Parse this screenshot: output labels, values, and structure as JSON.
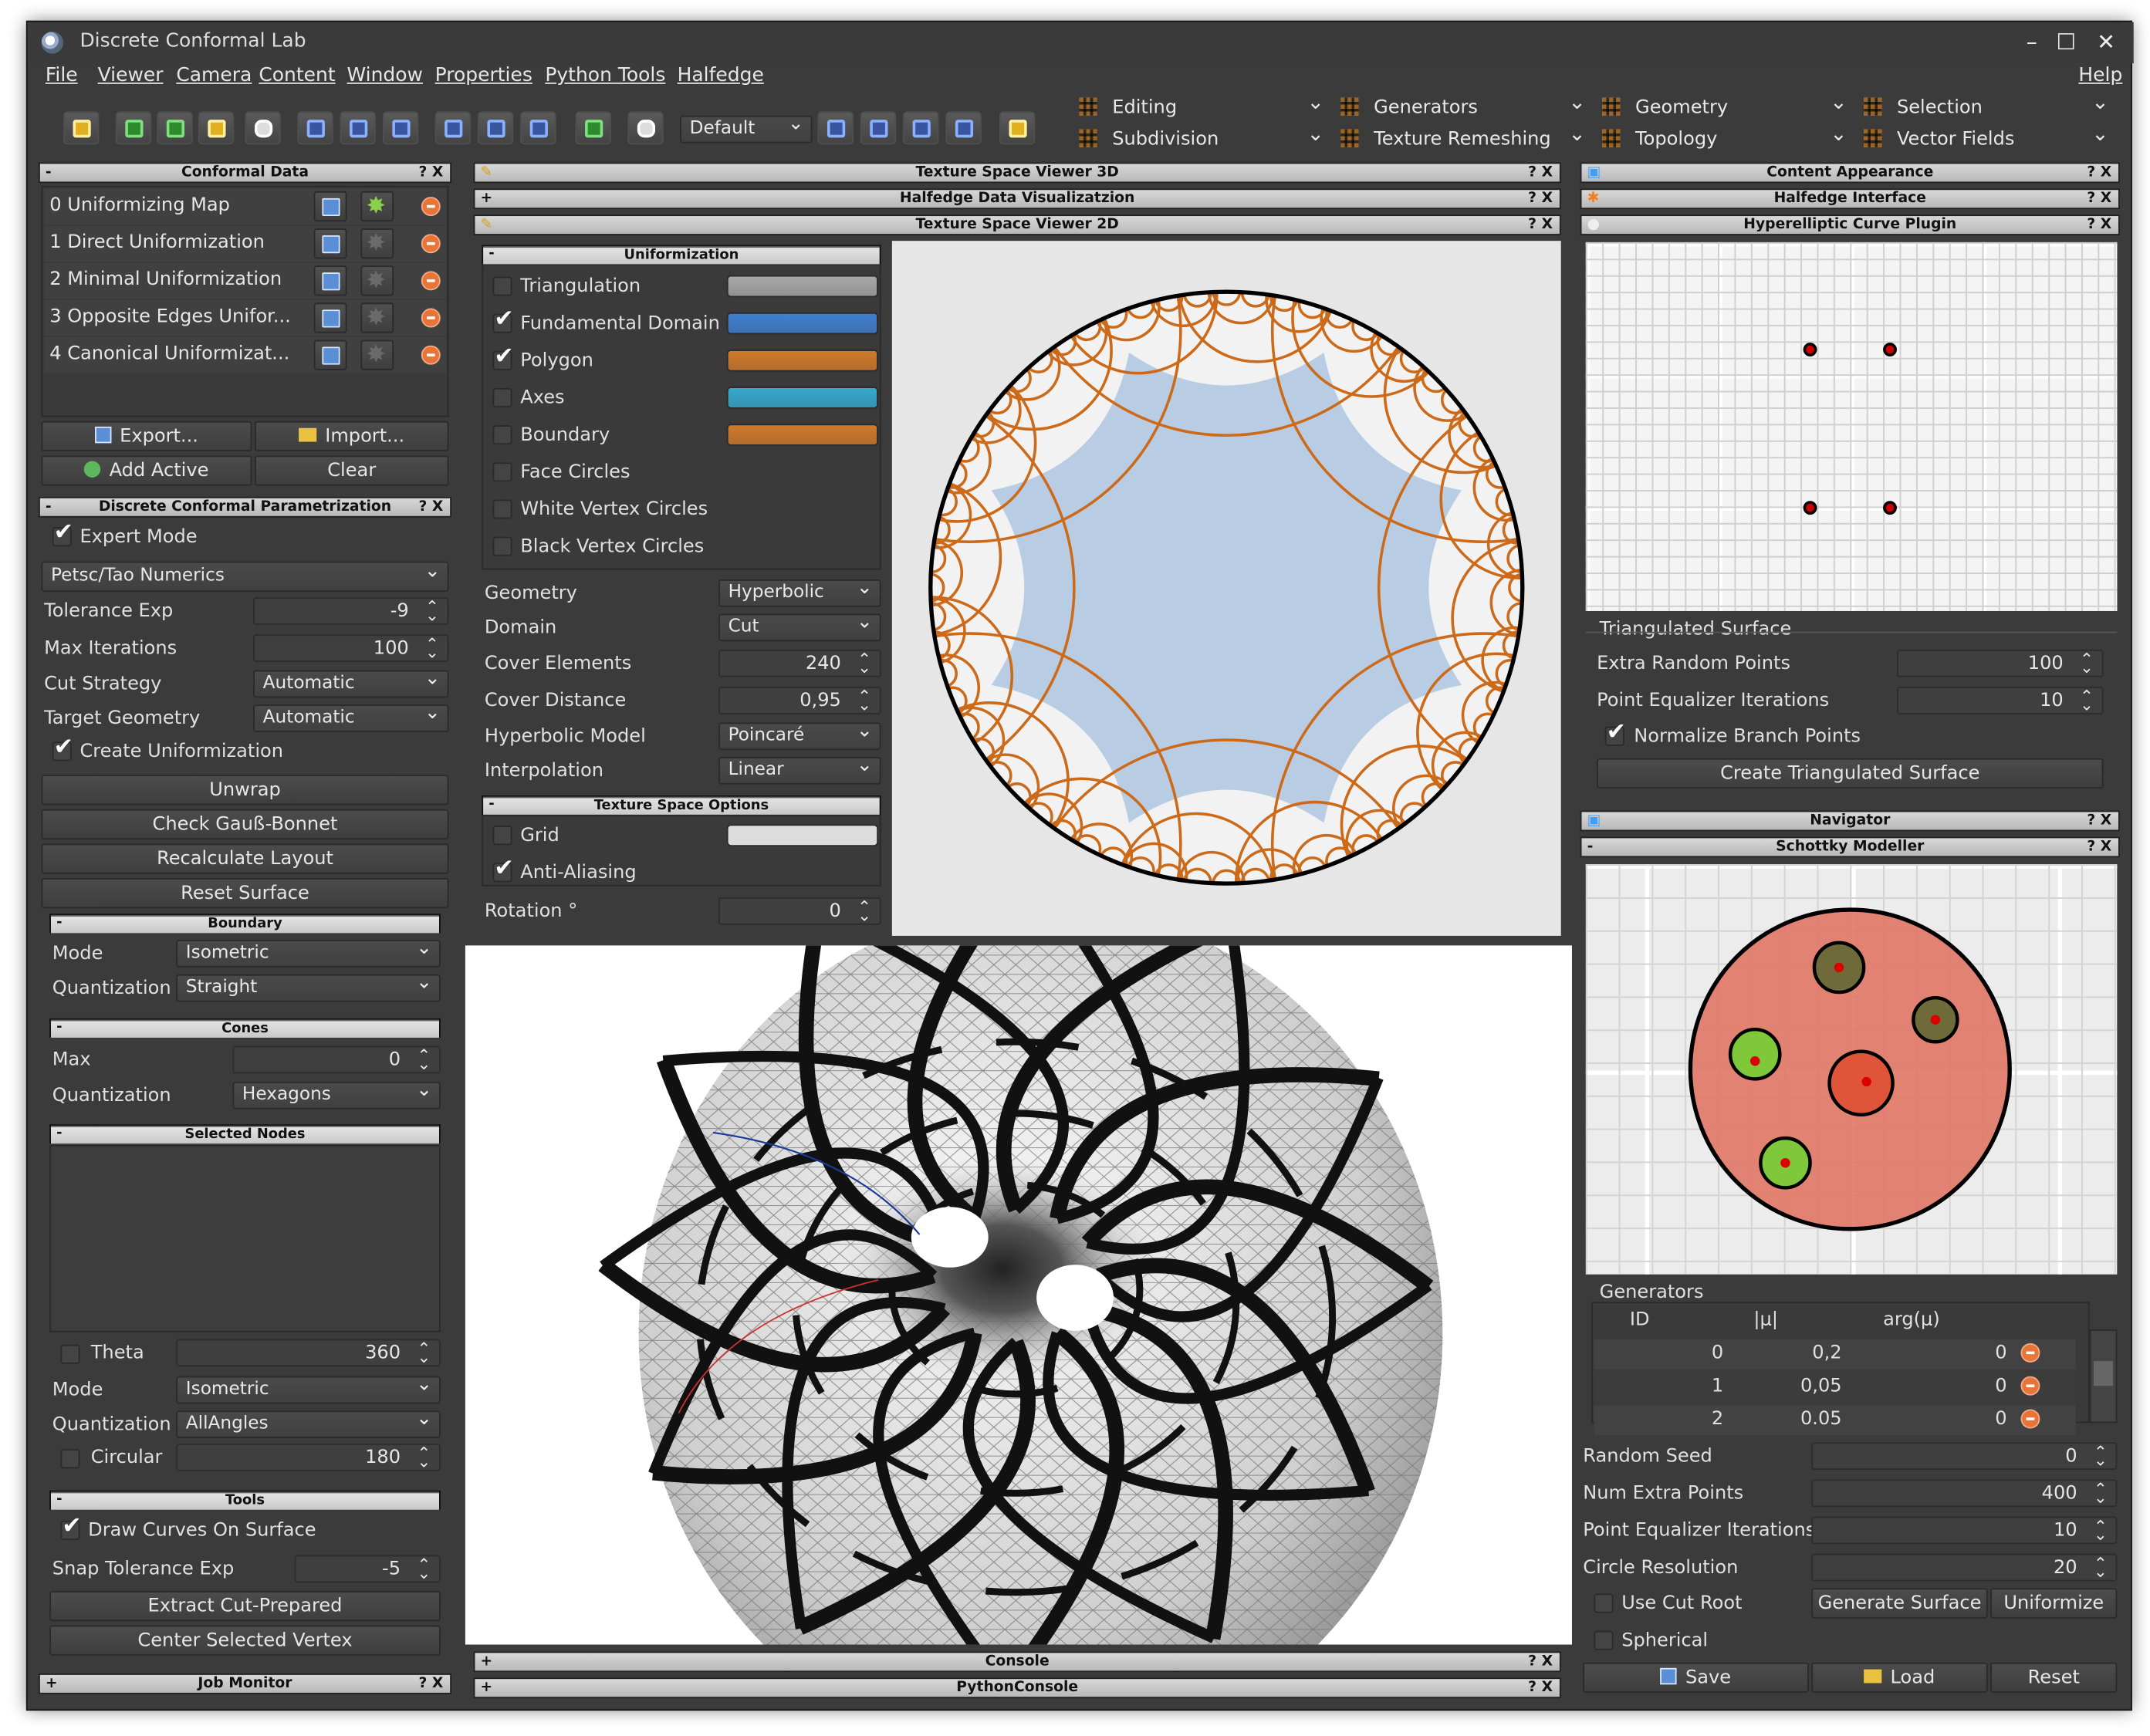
{
  "app": {
    "title": "Discrete Conformal Lab",
    "help": "Help"
  },
  "menu": [
    "File",
    "Viewer",
    "Camera",
    "Content",
    "Window",
    "Properties",
    "Python Tools",
    "Halfedge"
  ],
  "toolbar": {
    "preset": "Default"
  },
  "plugin_combos": [
    "Editing",
    "Generators",
    "Geometry",
    "Selection",
    "Subdivision",
    "Texture Remeshing",
    "Topology",
    "Vector Fields"
  ],
  "conformal_data": {
    "title": "Conformal Data",
    "items": [
      "0 Uniformizing Map",
      "1 Direct Uniformization",
      "2 Minimal Uniformization",
      "3 Opposite Edges Unifor...",
      "4 Canonical Uniformizat..."
    ],
    "export": "Export...",
    "import": "Import...",
    "add_active": "Add Active",
    "clear": "Clear"
  },
  "dcp": {
    "title": "Discrete Conformal Parametrization",
    "expert_mode": "Expert Mode",
    "numerics": "Petsc/Tao Numerics",
    "tolerance_label": "Tolerance Exp",
    "tolerance": "-9",
    "maxit_label": "Max Iterations",
    "maxit": "100",
    "cut_label": "Cut Strategy",
    "cut": "Automatic",
    "target_label": "Target Geometry",
    "target": "Automatic",
    "create_unif": "Create Uniformization",
    "unwrap": "Unwrap",
    "check": "Check Gauß-Bonnet",
    "recalc": "Recalculate Layout",
    "reset": "Reset Surface"
  },
  "boundary": {
    "title": "Boundary",
    "mode_label": "Mode",
    "mode": "Isometric",
    "quant_label": "Quantization",
    "quant": "Straight"
  },
  "cones": {
    "title": "Cones",
    "max_label": "Max",
    "max": "0",
    "quant_label": "Quantization",
    "quant": "Hexagons"
  },
  "selected_nodes": {
    "title": "Selected Nodes",
    "theta_label": "Theta",
    "theta": "360",
    "mode_label": "Mode",
    "mode": "Isometric",
    "quant_label": "Quantization",
    "quant": "AllAngles",
    "circular_label": "Circular",
    "circular": "180"
  },
  "tools": {
    "title": "Tools",
    "draw_curves": "Draw Curves On Surface",
    "snap_label": "Snap Tolerance Exp",
    "snap": "-5",
    "extract": "Extract Cut-Prepared",
    "center": "Center Selected Vertex"
  },
  "job_monitor": "Job Monitor",
  "center_panels": {
    "tsv3d": "Texture Space Viewer 3D",
    "hdv": "Halfedge Data Visualizatzion",
    "tsv2d": "Texture Space Viewer 2D",
    "console": "Console",
    "pyconsole": "PythonConsole"
  },
  "uniformization": {
    "title": "Uniformization",
    "items": [
      {
        "label": "Triangulation",
        "checked": false,
        "color": "#a8a8a8"
      },
      {
        "label": "Fundamental Domain",
        "checked": true,
        "color": "#3f7fd0"
      },
      {
        "label": "Polygon",
        "checked": true,
        "color": "#d07a2a"
      },
      {
        "label": "Axes",
        "checked": false,
        "color": "#36a9cf"
      },
      {
        "label": "Boundary",
        "checked": false,
        "color": "#d07a2a"
      },
      {
        "label": "Face Circles",
        "checked": false
      },
      {
        "label": "White Vertex Circles",
        "checked": false
      },
      {
        "label": "Black Vertex Circles",
        "checked": false
      }
    ],
    "geometry_label": "Geometry",
    "geometry": "Hyperbolic",
    "domain_label": "Domain",
    "domain": "Cut",
    "cover_el_label": "Cover Elements",
    "cover_el": "240",
    "cover_dist_label": "Cover Distance",
    "cover_dist": "0,95",
    "model_label": "Hyperbolic Model",
    "model": "Poincaré",
    "interp_label": "Interpolation",
    "interp": "Linear"
  },
  "texture_options": {
    "title": "Texture Space Options",
    "grid": "Grid",
    "aa": "Anti-Aliasing",
    "rotation_label": "Rotation °",
    "rotation": "0"
  },
  "right": {
    "content_appearance": "Content Appearance",
    "halfedge_interface": "Halfedge Interface",
    "hyperelliptic": "Hyperelliptic Curve Plugin",
    "tri_surface": "Triangulated Surface",
    "extra_label": "Extra Random Points",
    "extra": "100",
    "peq_label": "Point Equalizer Iterations",
    "peq": "10",
    "normalize": "Normalize Branch Points",
    "create_tri": "Create Triangulated Surface",
    "navigator": "Navigator",
    "schottky": "Schottky Modeller",
    "generators": "Generators",
    "gen_cols": [
      "ID",
      "|μ|",
      "arg(μ)"
    ],
    "gen_rows": [
      [
        "0",
        "0,2",
        "0"
      ],
      [
        "1",
        "0,05",
        "0"
      ],
      [
        "2",
        "0.05",
        "0"
      ]
    ],
    "seed_label": "Random Seed",
    "seed": "0",
    "nextra_label": "Num Extra Points",
    "nextra": "400",
    "peq2_label": "Point Equalizer Iterations",
    "peq2": "10",
    "circres_label": "Circle Resolution",
    "circres": "20",
    "use_cut_root": "Use Cut Root",
    "gen_surface": "Generate Surface",
    "uniformize": "Uniformize",
    "spherical": "Spherical",
    "save": "Save",
    "load": "Load",
    "reset": "Reset"
  },
  "colors": {
    "panel_bg": "#3b3b3b",
    "polygon": "#cc6a1a",
    "domain_fill": "#b8cde3",
    "schottky_disk": "#e07766"
  }
}
